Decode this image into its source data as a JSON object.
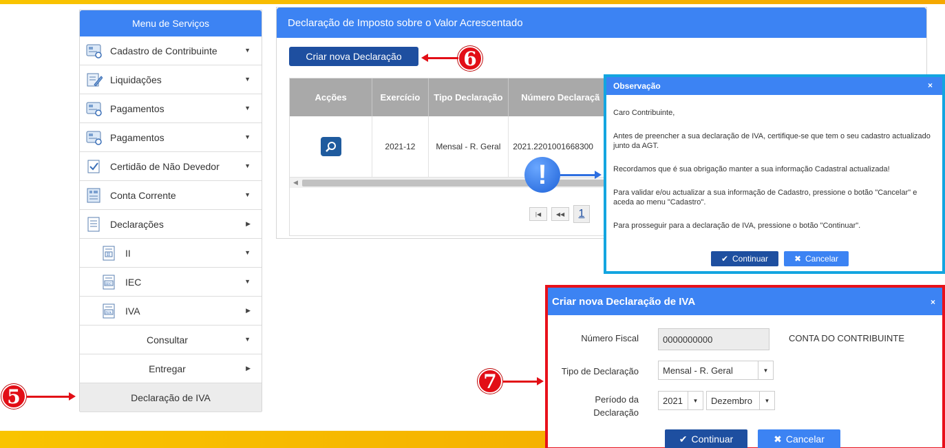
{
  "sidebar": {
    "title": "Menu de Serviços",
    "items": [
      {
        "label": "Cadastro de Contribuinte",
        "icon": "card-icon",
        "caret": "▼"
      },
      {
        "label": "Liquidações",
        "icon": "edit-document-icon",
        "caret": "▼"
      },
      {
        "label": "Pagamentos",
        "icon": "card-icon",
        "caret": "▼"
      },
      {
        "label": "Pagamentos",
        "icon": "card-icon",
        "caret": "▼"
      },
      {
        "label": "Certidão de Não Devedor",
        "icon": "checked-document-icon",
        "caret": "▼"
      },
      {
        "label": "Conta Corrente",
        "icon": "ledger-icon",
        "caret": "▼"
      },
      {
        "label": "Declarações",
        "icon": "document-icon",
        "caret": "▶"
      },
      {
        "label": "II",
        "icon": "document-ii-icon",
        "caret": "▼"
      },
      {
        "label": "IEC",
        "icon": "document-iec-icon",
        "caret": "▼"
      },
      {
        "label": "IVA",
        "icon": "document-iva-icon",
        "caret": "▶"
      },
      {
        "label": "Consultar",
        "caret": "▼"
      },
      {
        "label": "Entregar",
        "caret": "▶"
      },
      {
        "label": "Declaração de IVA"
      }
    ]
  },
  "main": {
    "title": "Declaração de Imposto sobre o Valor Acrescentado",
    "create_button": "Criar nova Declaração",
    "table": {
      "headers": [
        "Acções",
        "Exercício",
        "Tipo Declaração",
        "Número Declaraçã"
      ],
      "row": {
        "exercicio": "2021-12",
        "tipo": "Mensal - R. Geral",
        "numero": "2021.2201001668300"
      }
    },
    "pager": {
      "first": "|◀",
      "prev": "◀◀",
      "current": "1"
    }
  },
  "observation": {
    "title": "Observação",
    "close": "×",
    "greeting": "Caro Contribuinte,",
    "p1": "Antes de preencher a sua declaração de IVA, certifique-se que tem o seu cadastro actualizado junto da AGT.",
    "p2": "Recordamos que é sua obrigação manter a sua informação Cadastral actualizada!",
    "p3": "Para validar e/ou actualizar a sua informação de Cadastro, pressione o botão \"Cancelar\" e aceda ao menu \"Cadastro\".",
    "p4": "Para prosseguir para a declaração de IVA, pressione o botão \"Continuar\".",
    "continue": "Continuar",
    "cancel": "Cancelar"
  },
  "create_dialog": {
    "title": "Criar nova Declaração de IVA",
    "close": "×",
    "nif_label": "Número Fiscal",
    "nif_value": "0000000000",
    "account_label": "CONTA DO CONTRIBUINTE",
    "type_label": "Tipo de Declaração",
    "type_value": "Mensal - R. Geral",
    "period_label_1": "Período da",
    "period_label_2": "Declaração",
    "year_value": "2021",
    "month_value": "Dezembro",
    "continue": "Continuar",
    "cancel": "Cancelar"
  },
  "badges": {
    "five": "5",
    "six": "6",
    "seven": "7",
    "exclamation": "!"
  },
  "colors": {
    "header_blue": "#3c83f3",
    "button_navy": "#1e4fa0",
    "badge_red": "#e20e16",
    "obs_border": "#13a5e0",
    "stripe_yellow": "#f9c400"
  }
}
